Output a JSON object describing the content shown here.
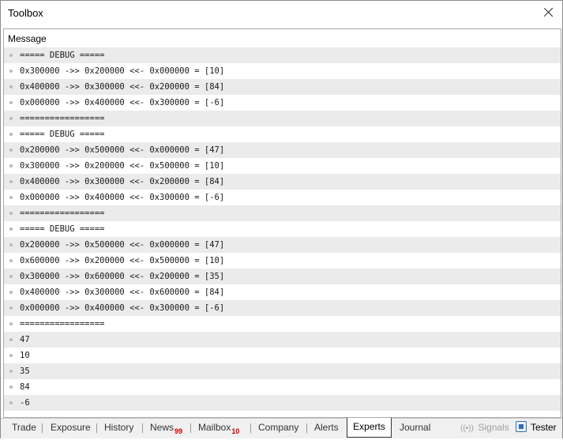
{
  "window": {
    "title": "Toolbox"
  },
  "log": {
    "column_header": "Message",
    "rows": [
      "===== DEBUG =====",
      "0x300000 ->> 0x200000 <<- 0x000000 = [10]",
      "0x400000 ->> 0x300000 <<- 0x200000 = [84]",
      "0x000000 ->> 0x400000 <<- 0x300000 = [-6]",
      "=================",
      "===== DEBUG =====",
      "0x200000 ->> 0x500000 <<- 0x000000 = [47]",
      "0x300000 ->> 0x200000 <<- 0x500000 = [10]",
      "0x400000 ->> 0x300000 <<- 0x200000 = [84]",
      "0x000000 ->> 0x400000 <<- 0x300000 = [-6]",
      "=================",
      "===== DEBUG =====",
      "0x200000 ->> 0x500000 <<- 0x000000 = [47]",
      "0x600000 ->> 0x200000 <<- 0x500000 = [10]",
      "0x300000 ->> 0x600000 <<- 0x200000 = [35]",
      "0x400000 ->> 0x300000 <<- 0x600000 = [84]",
      "0x000000 ->> 0x400000 <<- 0x300000 = [-6]",
      "=================",
      "47",
      "10",
      "35",
      "84",
      "-6"
    ]
  },
  "tabs": {
    "trade": "Trade",
    "exposure": "Exposure",
    "history": "History",
    "news": "News",
    "news_badge": "99",
    "mailbox": "Mailbox",
    "mailbox_badge": "10",
    "company": "Company",
    "alerts": "Alerts",
    "experts": "Experts",
    "journal": "Journal",
    "signals": "Signals",
    "tester": "Tester",
    "active": "Experts"
  },
  "colors": {
    "row_alt": "#ebebeb",
    "badge": "#d00000",
    "tester_icon": "#2a6fbf"
  }
}
